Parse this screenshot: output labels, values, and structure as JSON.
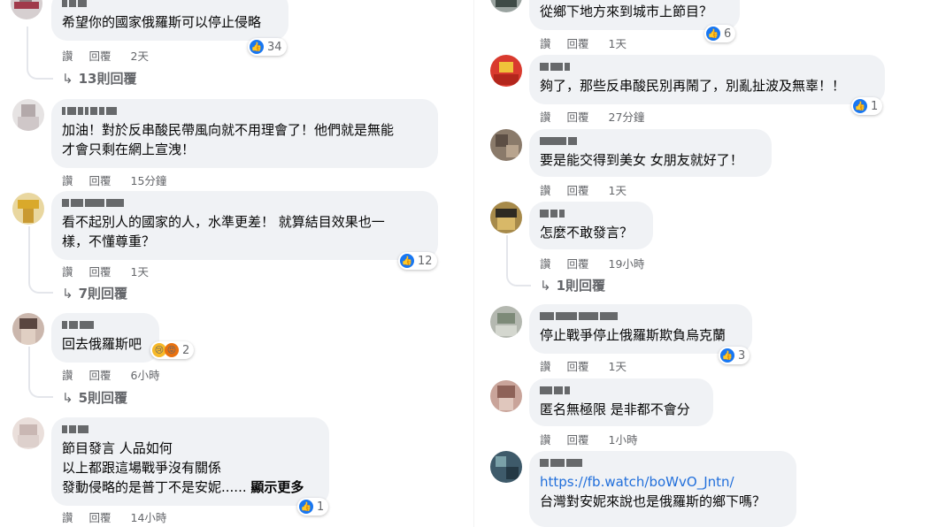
{
  "actions": {
    "like": "讚",
    "reply": "回覆"
  },
  "left": [
    {
      "text": "希望你的國家俄羅斯可以停止侵略",
      "time": "2天",
      "likes": "34",
      "replies": "13則回覆"
    },
    {
      "text": "加油！對於反串酸民帶風向就不用理會了！他們就是無能\n才會只剩在網上宣洩！",
      "time": "15分鐘"
    },
    {
      "text": "看不起別人的國家的人，水準更差！ 就算結目效果也一\n樣，不懂尊重？",
      "time": "1天",
      "likes": "12",
      "replies": "7則回覆"
    },
    {
      "text": "回去俄羅斯吧",
      "time": "6小時",
      "likes": "2",
      "reactions": [
        "sad-icon",
        "angry-icon"
      ],
      "replies": "5則回覆"
    },
    {
      "text": "節目發言 人品如何\n以上都跟這場戰爭沒有關係\n發動侵略的是普丁不是安妮......",
      "more": "顯示更多",
      "time": "14小時",
      "likes": "1"
    }
  ],
  "right": [
    {
      "text": "從鄉下地方來到城市上節目？",
      "time": "1天",
      "likes": "6"
    },
    {
      "text": "夠了，那些反串酸民別再鬧了，別亂扯波及無辜！！",
      "time": "27分鐘",
      "likes": "1"
    },
    {
      "text": "要是能交得到美女 女朋友就好了！",
      "time": "1天"
    },
    {
      "text": "怎麼不敢發言？",
      "time": "19小時",
      "replies": "1則回覆"
    },
    {
      "text": "停止戰爭停止俄羅斯欺負烏克蘭",
      "time": "1天",
      "likes": "3"
    },
    {
      "text": "匿名無極限 是非都不會分",
      "time": "1小時"
    },
    {
      "link": "https://fb.watch/boWvO_Jntn/",
      "text": "台灣對安妮來說也是俄羅斯的鄉下嗎？"
    }
  ],
  "colors": {
    "bubble": "#f0f2f5",
    "like_blue": "#1877f2",
    "link": "#216fdb",
    "meta": "#65676b"
  }
}
